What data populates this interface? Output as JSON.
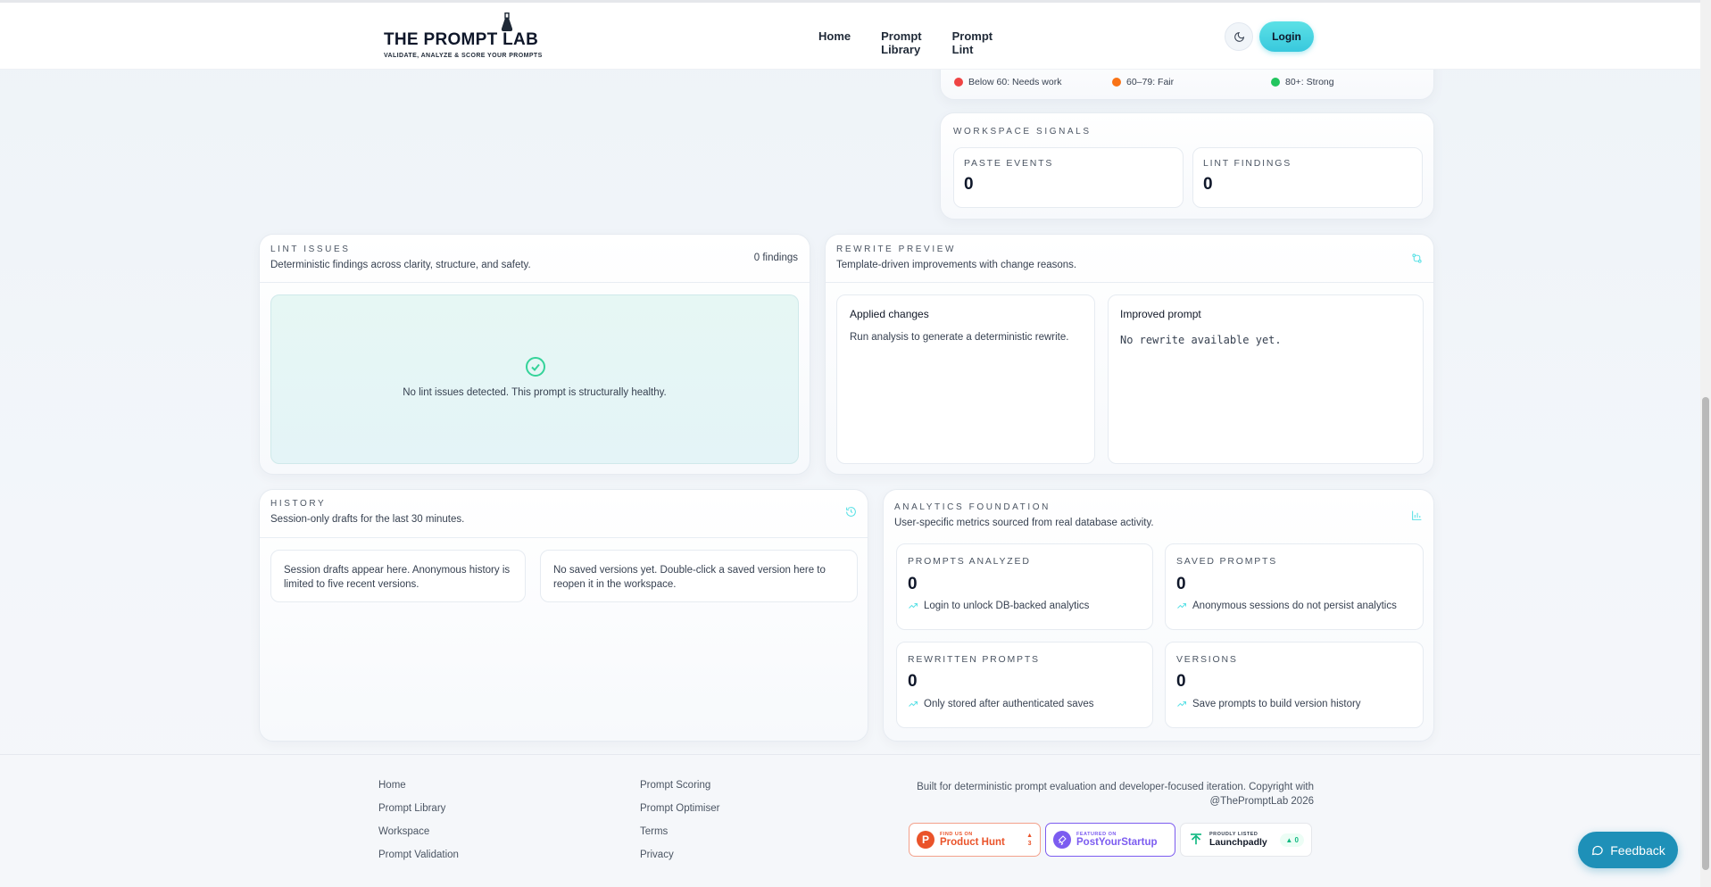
{
  "header": {
    "logo_title": "THE PROMPT LAB",
    "logo_subtitle": "VALIDATE, ANALYZE & SCORE YOUR PROMPTS",
    "nav": [
      "Home",
      "Prompt Library",
      "Prompt Lint"
    ],
    "login_label": "Login"
  },
  "score_legend": {
    "items": [
      {
        "label": "Below 60: Needs work",
        "color": "#ef4444"
      },
      {
        "label": "60–79: Fair",
        "color": "#f97316"
      },
      {
        "label": "80+: Strong",
        "color": "#22c55e"
      }
    ]
  },
  "workspace_signals": {
    "title": "WORKSPACE SIGNALS",
    "paste_events_label": "PASTE EVENTS",
    "paste_events_value": "0",
    "lint_findings_label": "LINT FINDINGS",
    "lint_findings_value": "0"
  },
  "lint_issues": {
    "title": "LINT ISSUES",
    "subtitle": "Deterministic findings across clarity, structure, and safety.",
    "count": "0 findings",
    "empty_message": "No lint issues detected. This prompt is structurally healthy."
  },
  "rewrite_preview": {
    "title": "REWRITE PREVIEW",
    "subtitle": "Template-driven improvements with change reasons.",
    "applied_title": "Applied changes",
    "applied_body": "Run analysis to generate a deterministic rewrite.",
    "improved_title": "Improved prompt",
    "improved_body": "No rewrite available yet."
  },
  "history": {
    "title": "HISTORY",
    "subtitle": "Session-only drafts for the last 30 minutes.",
    "drafts_note": "Session drafts appear here. Anonymous history is limited to five recent versions.",
    "saved_note": "No saved versions yet. Double-click a saved version here to reopen it in the workspace."
  },
  "analytics": {
    "title": "ANALYTICS FOUNDATION",
    "subtitle": "User-specific metrics sourced from real database activity.",
    "metrics": [
      {
        "label": "PROMPTS ANALYZED",
        "value": "0",
        "note": "Login to unlock DB-backed analytics"
      },
      {
        "label": "SAVED PROMPTS",
        "value": "0",
        "note": "Anonymous sessions do not persist analytics"
      },
      {
        "label": "REWRITTEN PROMPTS",
        "value": "0",
        "note": "Only stored after authenticated saves"
      },
      {
        "label": "VERSIONS",
        "value": "0",
        "note": "Save prompts to build version history"
      }
    ]
  },
  "footer": {
    "col1": [
      "Home",
      "Prompt Library",
      "Workspace",
      "Prompt Validation"
    ],
    "col2": [
      "Prompt Scoring",
      "Prompt Optimiser",
      "Terms",
      "Privacy"
    ],
    "copyright": "Built for deterministic prompt evaluation and developer-focused iteration. Copyright with @ThePromptLab 2026",
    "badges": {
      "ph_small": "FIND US ON",
      "ph_big": "Product Hunt",
      "ph_count": "3",
      "pys_small": "FEATURED ON",
      "pys_big": "PostYourStartup",
      "lp_small": "PROUDLY LISTED",
      "lp_big": "Launchpadly",
      "lp_count": "0"
    }
  },
  "feedback_label": "Feedback",
  "colors": {
    "accent": "#38c8dd",
    "feedback": "#1e90b8",
    "success": "#34d399"
  }
}
